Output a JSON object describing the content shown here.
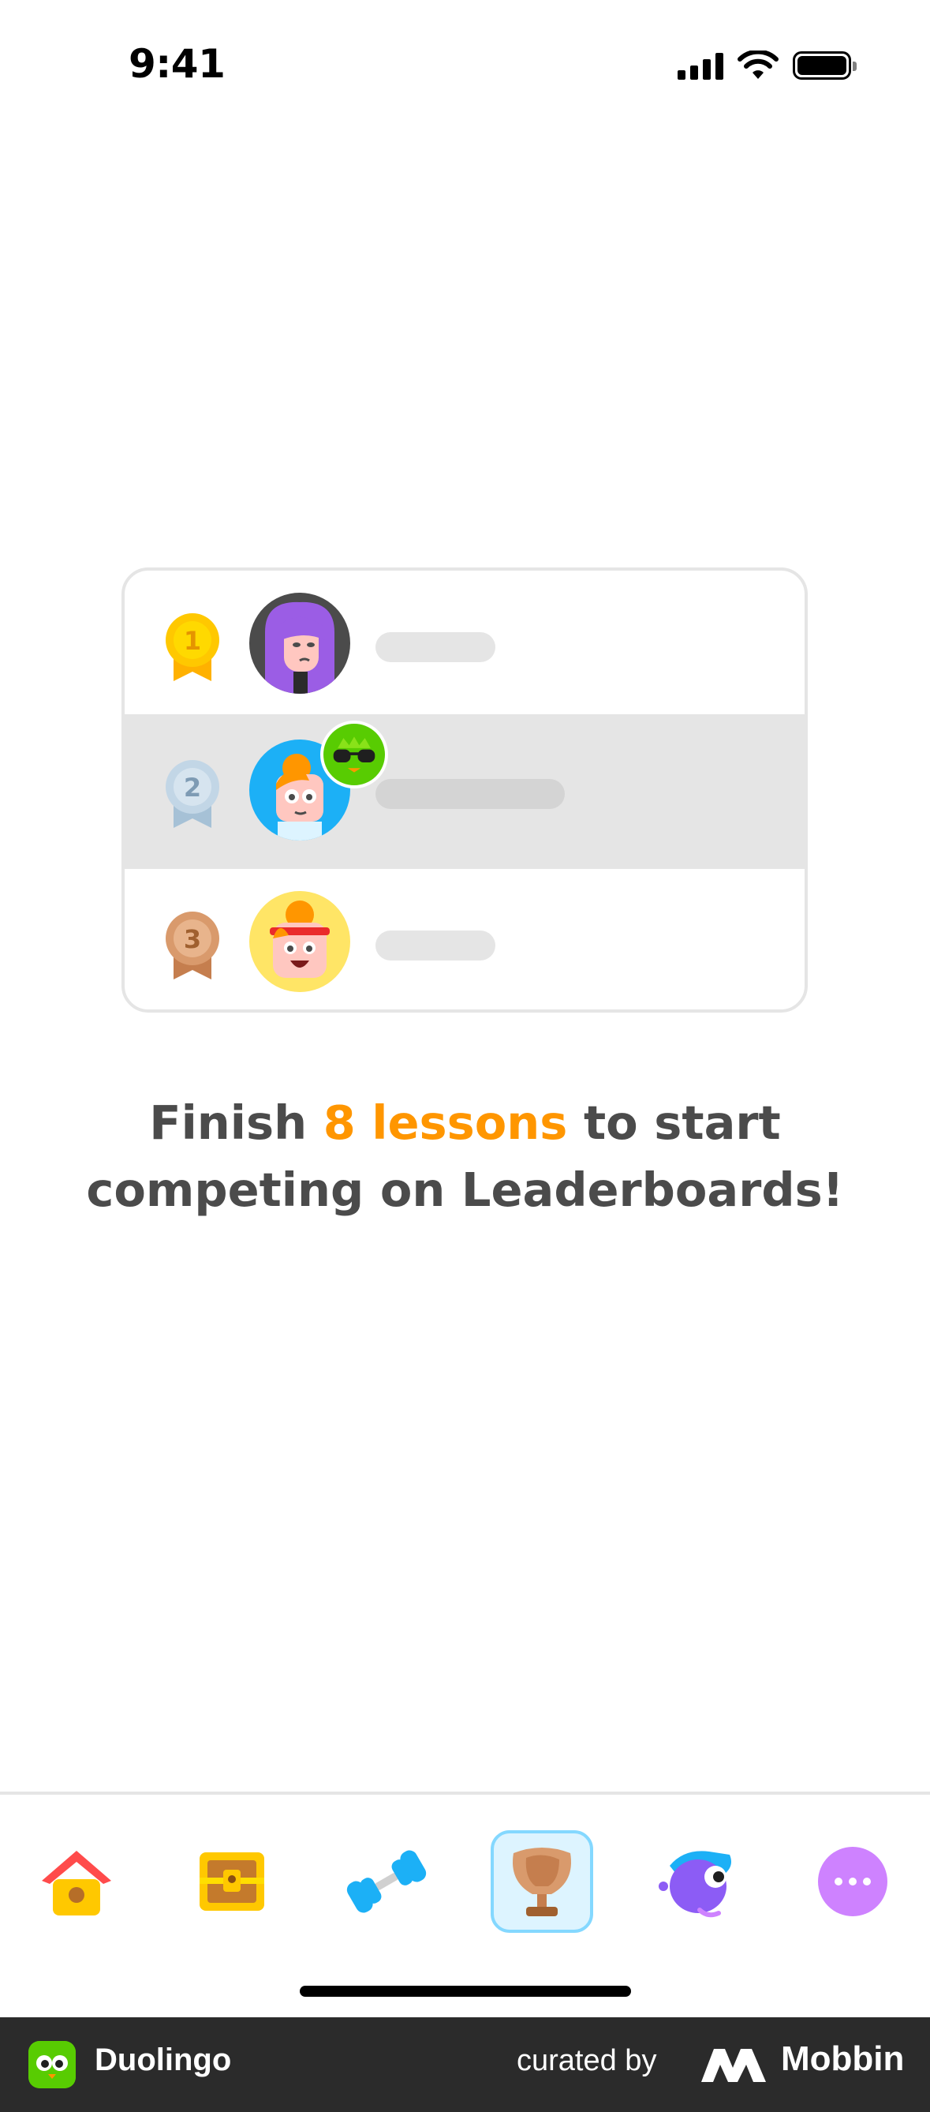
{
  "status_bar": {
    "time": "9:41"
  },
  "leaderboard": {
    "rows": [
      {
        "rank": "1",
        "medal": "gold-medal-icon"
      },
      {
        "rank": "2",
        "medal": "silver-medal-icon",
        "highlighted": true
      },
      {
        "rank": "3",
        "medal": "bronze-medal-icon"
      }
    ]
  },
  "message": {
    "prefix": "Finish ",
    "highlight": "8 lessons",
    "suffix": " to start competing on Leaderboards!"
  },
  "colors": {
    "highlight": "#ff9600",
    "text": "#4b4b4b",
    "active_tab_border": "#84d8ff"
  },
  "tabs": [
    {
      "icon": "home-icon",
      "active": false
    },
    {
      "icon": "treasure-chest-icon",
      "active": false
    },
    {
      "icon": "dumbbell-icon",
      "active": false
    },
    {
      "icon": "trophy-icon",
      "active": true
    },
    {
      "icon": "bird-character-icon",
      "active": false
    },
    {
      "icon": "more-icon",
      "active": false
    }
  ],
  "footer": {
    "app_name": "Duolingo",
    "curated_by": "curated by",
    "brand": "Mobbin"
  }
}
